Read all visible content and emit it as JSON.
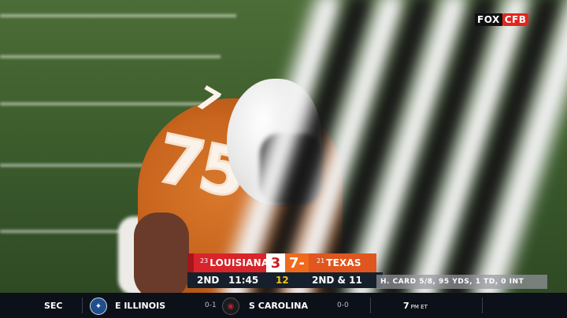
{
  "network": {
    "fox": "FOX",
    "cfb": "CFB"
  },
  "player": {
    "jersey_number": "75"
  },
  "scorebug": {
    "away": {
      "rank": "23",
      "name": "LOUISIANA",
      "score": "3",
      "color": "#d8242b"
    },
    "home": {
      "rank": "21",
      "name": "TEXAS",
      "score": "7",
      "possession_marker": "-",
      "color": "#e0561e"
    },
    "quarter": "2ND",
    "clock": "11:45",
    "play_clock": "12",
    "down_distance": "2ND & 11",
    "stat_line": "H. CARD 5/8, 95 YDS, 1 TD, 0 INT"
  },
  "ticker": {
    "conference": "SEC",
    "team1": {
      "name": "E ILLINOIS",
      "record": "0-1",
      "logo": "eastern-illinois-logo"
    },
    "team2": {
      "name": "S CAROLINA",
      "record": "0-0",
      "logo": "south-carolina-logo"
    },
    "time": "7",
    "time_suffix": "PM ET"
  }
}
